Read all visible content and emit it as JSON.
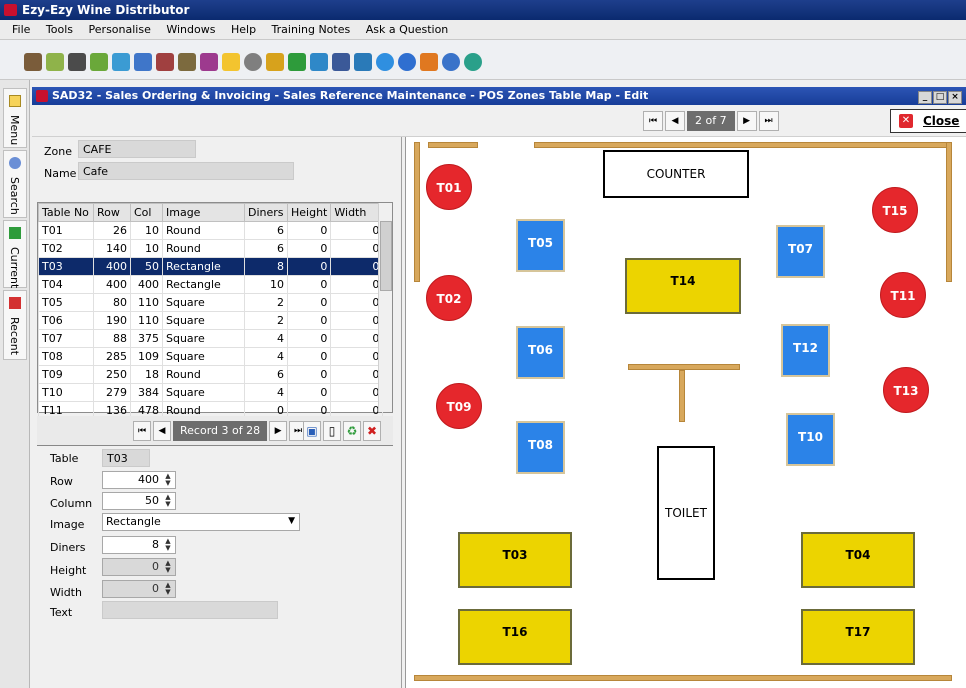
{
  "app": {
    "title": "Ezy-Ezy Wine Distributor"
  },
  "menu": [
    "File",
    "Tools",
    "Personalise",
    "Windows",
    "Help",
    "Training Notes",
    "Ask a Question"
  ],
  "sidebar": [
    "Menu",
    "Search",
    "Current",
    "Recent"
  ],
  "window": {
    "title": "SAD32 - Sales Ordering & Invoicing - Sales Reference Maintenance - POS Zones Table Map - Edit",
    "zone_nav": "2 of 7",
    "close_label": "Close"
  },
  "zone": {
    "zone_label": "Zone",
    "zone_value": "CAFE",
    "name_label": "Name",
    "name_value": "Cafe"
  },
  "grid": {
    "headers": [
      "Table No",
      "Row",
      "Col",
      "Image",
      "Diners",
      "Height",
      "Width"
    ],
    "rows": [
      [
        "T01",
        "26",
        "10",
        "Round",
        "6",
        "0",
        "0"
      ],
      [
        "T02",
        "140",
        "10",
        "Round",
        "6",
        "0",
        "0"
      ],
      [
        "T03",
        "400",
        "50",
        "Rectangle",
        "8",
        "0",
        "0"
      ],
      [
        "T04",
        "400",
        "400",
        "Rectangle",
        "10",
        "0",
        "0"
      ],
      [
        "T05",
        "80",
        "110",
        "Square",
        "2",
        "0",
        "0"
      ],
      [
        "T06",
        "190",
        "110",
        "Square",
        "2",
        "0",
        "0"
      ],
      [
        "T07",
        "88",
        "375",
        "Square",
        "4",
        "0",
        "0"
      ],
      [
        "T08",
        "285",
        "109",
        "Square",
        "4",
        "0",
        "0"
      ],
      [
        "T09",
        "250",
        "18",
        "Round",
        "6",
        "0",
        "0"
      ],
      [
        "T10",
        "279",
        "384",
        "Square",
        "4",
        "0",
        "0"
      ],
      [
        "T11",
        "136",
        "478",
        "Round",
        "0",
        "0",
        "0"
      ]
    ],
    "selected_index": 2,
    "record_label": "Record 3 of 28"
  },
  "form": {
    "table_label": "Table",
    "table_value": "T03",
    "row_label": "Row",
    "row_value": "400",
    "column_label": "Column",
    "column_value": "50",
    "image_label": "Image",
    "image_value": "Rectangle",
    "diners_label": "Diners",
    "diners_value": "8",
    "height_label": "Height",
    "height_value": "0",
    "width_label": "Width",
    "width_value": "0",
    "text_label": "Text",
    "text_value": ""
  },
  "map": {
    "counter": "COUNTER",
    "toilet": "TOILET",
    "round_tables": [
      "T01",
      "T02",
      "T09",
      "T15",
      "T11",
      "T13"
    ],
    "square_tables": [
      "T05",
      "T06",
      "T08",
      "T07",
      "T12",
      "T10"
    ],
    "rect_tables": [
      "T14",
      "T03",
      "T04",
      "T16",
      "T17"
    ]
  },
  "colors": {
    "round": "#e5272c",
    "square": "#2b83e8",
    "rect": "#ecd400",
    "wall": "#d8a85c",
    "selected_row": "#0d2a6a"
  }
}
